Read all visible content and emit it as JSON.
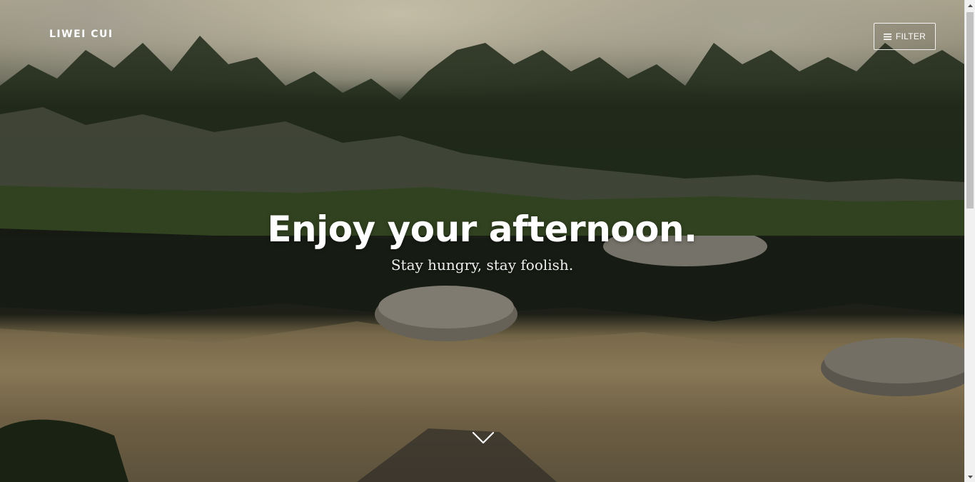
{
  "header": {
    "brand": "LIWEI CUI",
    "filter_label": "FILTER",
    "filter_icon": "hamburger-menu-icon"
  },
  "hero": {
    "title": "Enjoy your afternoon.",
    "subtitle": "Stay hungry, stay foolish.",
    "scroll_icon": "chevron-down-icon",
    "background": "mountain-lake-reflection-photo"
  },
  "colors": {
    "text": "#ffffff",
    "scrollbar_track": "#f1f1f1",
    "scrollbar_thumb": "#c1c1c1"
  }
}
